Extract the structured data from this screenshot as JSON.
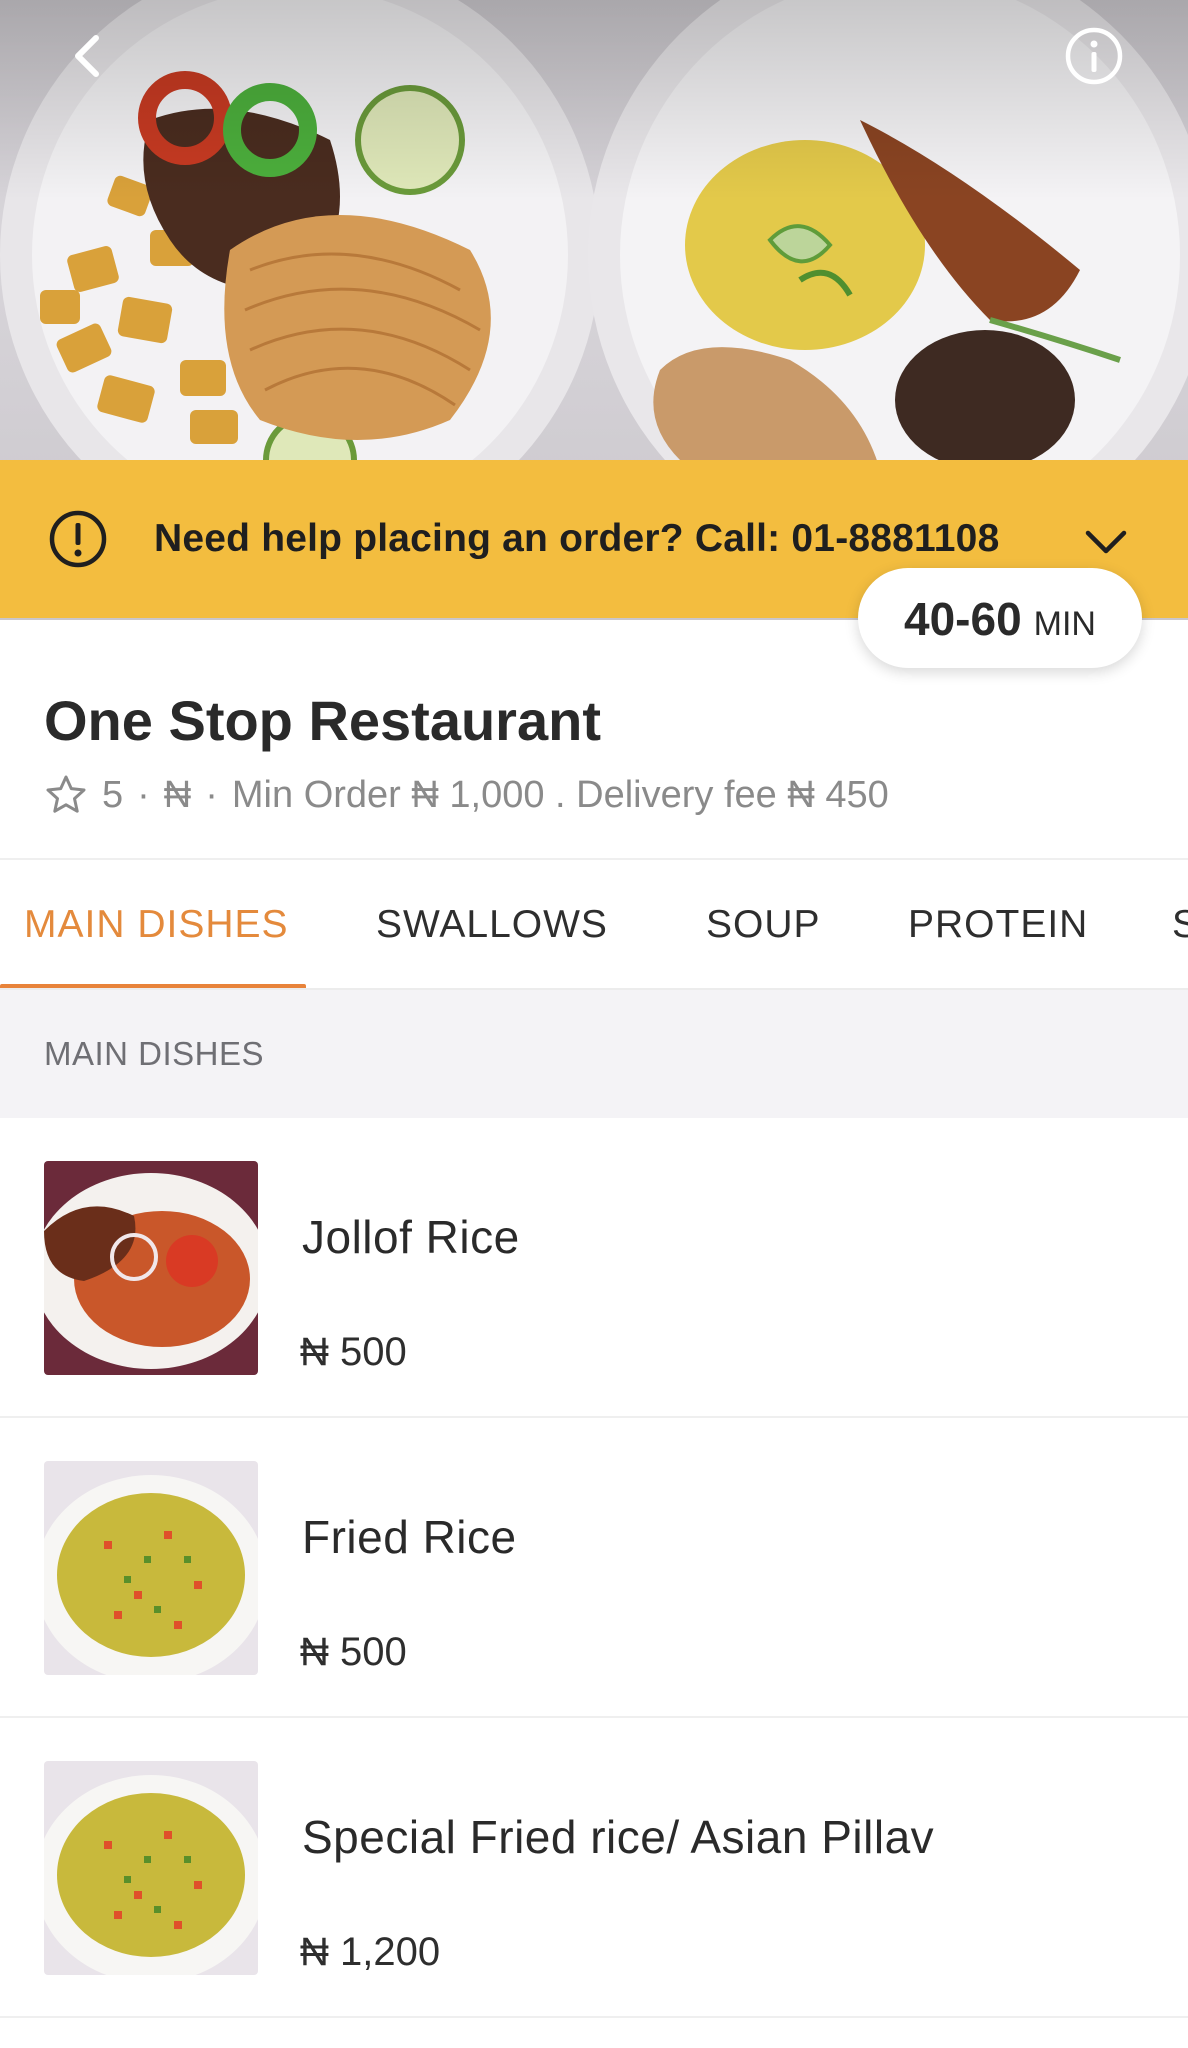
{
  "hero": {
    "back_icon": "chevron-left-icon",
    "info_icon": "info-circle-icon"
  },
  "help_banner": {
    "text": "Need help placing an order? Call: 01-8881108",
    "icon": "alert-circle-icon",
    "expand_icon": "chevron-down-icon",
    "background": "#f3bd3f"
  },
  "delivery_time": {
    "range": "40-60",
    "unit": "MIN"
  },
  "restaurant": {
    "name": "One Stop Restaurant",
    "rating": "5",
    "sep1": "·",
    "price_level": "₦",
    "sep2": "·",
    "min_order": "Min Order ₦ 1,000 . Delivery fee ₦ 450"
  },
  "tabs": [
    {
      "label": "MAIN DISHES",
      "active": true
    },
    {
      "label": "SWALLOWS",
      "active": false
    },
    {
      "label": "SOUP",
      "active": false
    },
    {
      "label": "PROTEIN",
      "active": false
    },
    {
      "label": "S",
      "active": false
    }
  ],
  "accent_color": "#e8833a",
  "section": {
    "title": "MAIN DISHES"
  },
  "menu_items": [
    {
      "name": "Jollof Rice",
      "price": "₦ 500"
    },
    {
      "name": "Fried Rice",
      "price": "₦ 500"
    },
    {
      "name": "Special Fried rice/ Asian Pillav",
      "price": "₦ 1,200"
    }
  ]
}
